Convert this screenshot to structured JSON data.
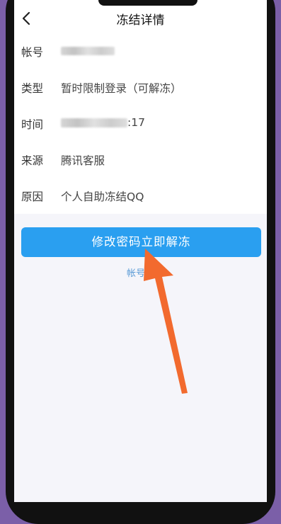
{
  "header": {
    "title": "冻结详情",
    "back_icon": "chevron-left-icon"
  },
  "details": {
    "account": {
      "label": "帐号"
    },
    "type": {
      "label": "类型",
      "value": "暂时限制登录（可解冻）"
    },
    "time": {
      "label": "时间",
      "visible_suffix": ":17"
    },
    "source": {
      "label": "来源",
      "value": "腾讯客服"
    },
    "reason": {
      "label": "原因",
      "value": "个人自助冻结QQ"
    }
  },
  "action": {
    "unfreeze_button": "修改密码立即解冻"
  },
  "footer": {
    "link_text": "帐号资"
  },
  "colors": {
    "accent": "#2a9ff0",
    "arrow": "#f26a2e",
    "link": "#5b9bd6"
  }
}
